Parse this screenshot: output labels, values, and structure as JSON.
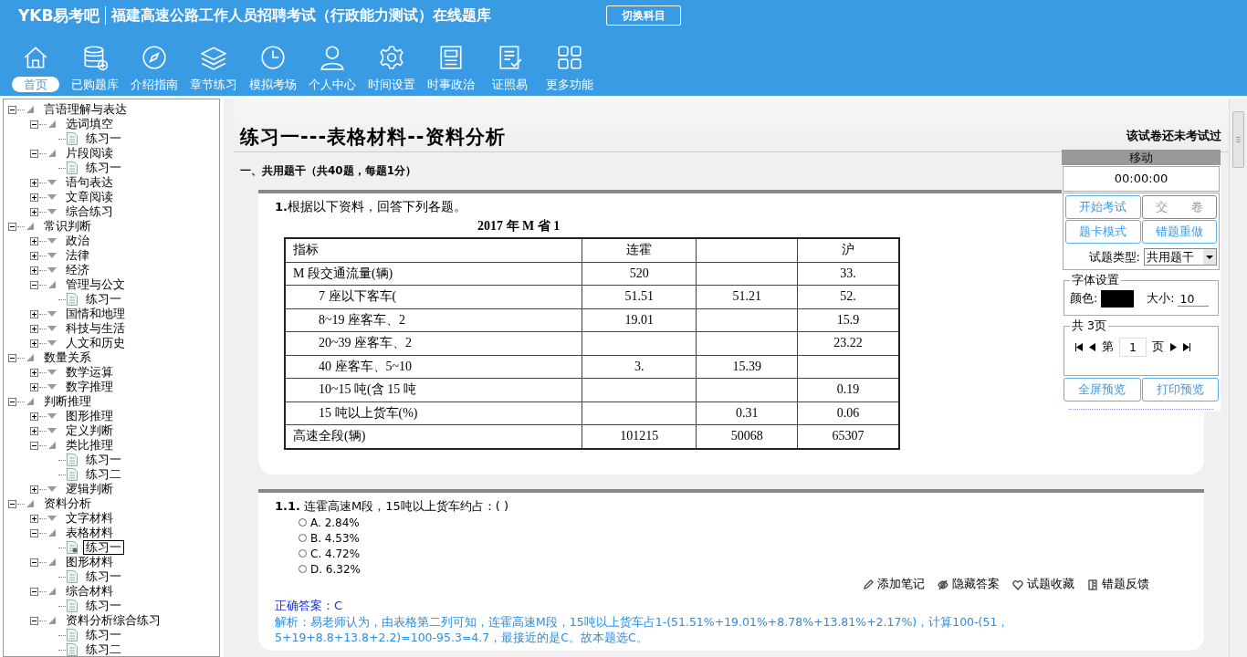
{
  "header": {
    "logo": "YKB易考吧",
    "title": "福建高速公路工作人员招聘考试（行政能力测试）在线题库",
    "switch_button": "切换科目"
  },
  "toolbar": [
    {
      "label": "首页",
      "selected": true
    },
    {
      "label": "已购题库",
      "selected": false
    },
    {
      "label": "介绍指南",
      "selected": false
    },
    {
      "label": "章节练习",
      "selected": false
    },
    {
      "label": "模拟考场",
      "selected": false
    },
    {
      "label": "个人中心",
      "selected": false
    },
    {
      "label": "时间设置",
      "selected": false
    },
    {
      "label": "时事政治",
      "selected": false
    },
    {
      "label": "证照易",
      "selected": false
    },
    {
      "label": "更多功能",
      "selected": false
    }
  ],
  "tree": [
    {
      "kind": "folder",
      "label": "言语理解与表达",
      "expanded": true,
      "children": [
        {
          "kind": "folder",
          "label": "选词填空",
          "expanded": true,
          "children": [
            {
              "kind": "doc",
              "label": "练习一",
              "selected": false
            }
          ]
        },
        {
          "kind": "folder",
          "label": "片段阅读",
          "expanded": true,
          "children": [
            {
              "kind": "doc",
              "label": "练习一",
              "selected": false
            }
          ]
        },
        {
          "kind": "folder",
          "label": "语句表达",
          "expanded": false
        },
        {
          "kind": "folder",
          "label": "文章阅读",
          "expanded": false
        },
        {
          "kind": "folder",
          "label": "综合练习",
          "expanded": false
        }
      ]
    },
    {
      "kind": "folder",
      "label": "常识判断",
      "expanded": true,
      "children": [
        {
          "kind": "folder",
          "label": "政治",
          "expanded": false
        },
        {
          "kind": "folder",
          "label": "法律",
          "expanded": false
        },
        {
          "kind": "folder",
          "label": "经济",
          "expanded": false
        },
        {
          "kind": "folder",
          "label": "管理与公文",
          "expanded": true,
          "children": [
            {
              "kind": "doc",
              "label": "练习一",
              "selected": false
            }
          ]
        },
        {
          "kind": "folder",
          "label": "国情和地理",
          "expanded": false
        },
        {
          "kind": "folder",
          "label": "科技与生活",
          "expanded": false
        },
        {
          "kind": "folder",
          "label": "人文和历史",
          "expanded": false
        }
      ]
    },
    {
      "kind": "folder",
      "label": "数量关系",
      "expanded": true,
      "children": [
        {
          "kind": "folder",
          "label": "数学运算",
          "expanded": false
        },
        {
          "kind": "folder",
          "label": "数字推理",
          "expanded": false
        }
      ]
    },
    {
      "kind": "folder",
      "label": "判断推理",
      "expanded": true,
      "children": [
        {
          "kind": "folder",
          "label": "图形推理",
          "expanded": false
        },
        {
          "kind": "folder",
          "label": "定义判断",
          "expanded": false
        },
        {
          "kind": "folder",
          "label": "类比推理",
          "expanded": true,
          "children": [
            {
              "kind": "doc",
              "label": "练习一",
              "selected": false
            },
            {
              "kind": "doc",
              "label": "练习二",
              "selected": false
            }
          ]
        },
        {
          "kind": "folder",
          "label": "逻辑判断",
          "expanded": false
        }
      ]
    },
    {
      "kind": "folder",
      "label": "资料分析",
      "expanded": true,
      "children": [
        {
          "kind": "folder",
          "label": "文字材料",
          "expanded": false
        },
        {
          "kind": "folder",
          "label": "表格材料",
          "expanded": true,
          "children": [
            {
              "kind": "doc",
              "label": "练习一",
              "selected": true
            }
          ]
        },
        {
          "kind": "folder",
          "label": "图形材料",
          "expanded": true,
          "children": [
            {
              "kind": "doc",
              "label": "练习一",
              "selected": false
            }
          ]
        },
        {
          "kind": "folder",
          "label": "综合材料",
          "expanded": true,
          "children": [
            {
              "kind": "doc",
              "label": "练习一",
              "selected": false
            }
          ]
        },
        {
          "kind": "folder",
          "label": "资料分析综合练习",
          "expanded": true,
          "children": [
            {
              "kind": "doc",
              "label": "练习一",
              "selected": false
            },
            {
              "kind": "doc",
              "label": "练习二",
              "selected": false
            }
          ]
        }
      ]
    }
  ],
  "paper": {
    "title": "练习一---表格材料--资料分析",
    "status": "该试卷还未考试过",
    "section": "一、共用题干（共40题，每题1分）"
  },
  "stem": {
    "number": "1.",
    "text": "根据以下资料，回答下列各题。",
    "table_title": "2017 年 M 省 1",
    "table_rows": [
      [
        "指标",
        "连霍",
        null,
        "沪"
      ],
      [
        "M 段交通流量(辆)",
        "520",
        null,
        "33."
      ],
      [
        "7 座以下客车(",
        "51.51",
        "51.21",
        "52."
      ],
      [
        "8~19 座客车、2",
        "19.01",
        null,
        "15.9"
      ],
      [
        "20~39 座客车、2",
        null,
        null,
        "23.22"
      ],
      [
        "40 座客车、5~10",
        "3.",
        "15.39",
        null
      ],
      [
        "10~15 吨(含 15 吨",
        null,
        null,
        "0.19"
      ],
      [
        "15 吨以上货车(%)",
        null,
        "0.31",
        "0.06"
      ],
      [
        "高速全段(辆)",
        "101215",
        "50068",
        "65307"
      ]
    ]
  },
  "question": {
    "number": "1.1.",
    "text": "连霍高速M段，15吨以上货车约占：( )",
    "options": [
      {
        "label": "A. 2.84%",
        "selected": false
      },
      {
        "label": "B. 4.53%",
        "selected": false
      },
      {
        "label": "C. 4.72%",
        "selected": false
      },
      {
        "label": "D. 6.32%",
        "selected": false
      }
    ],
    "actions": [
      "添加笔记",
      "隐藏答案",
      "试题收藏",
      "错题反馈"
    ],
    "answer": "正确答案：C",
    "analysis": "解析：易老师认为，由表格第二列可知，连霍高速M段，15吨以上货车占1-(51.51%+19.01%+8.78%+13.81%+2.17%)，计算100-(51，5+19+8.8+13.8+2.2)=100-95.3=4.7，最接近的是C。故本题选C。"
  },
  "panel": {
    "move": "移动",
    "timer": "00:00:00",
    "buttons": [
      {
        "label": "开始考试",
        "disabled": false
      },
      {
        "label": "交　　卷",
        "disabled": true
      },
      {
        "label": "题卡模式",
        "disabled": false
      },
      {
        "label": "错题重做",
        "disabled": false
      }
    ],
    "type_label": "试题类型:",
    "type_value": "共用题干",
    "font_legend": "字体设置",
    "color_label": "颜色:",
    "size_label": "大小:",
    "size_value": "10",
    "pages_legend": "共 3页",
    "page_prefix": "第",
    "page_value": "1",
    "page_suffix": "页",
    "bottom_buttons": [
      "全屏预览",
      "打印预览"
    ]
  }
}
